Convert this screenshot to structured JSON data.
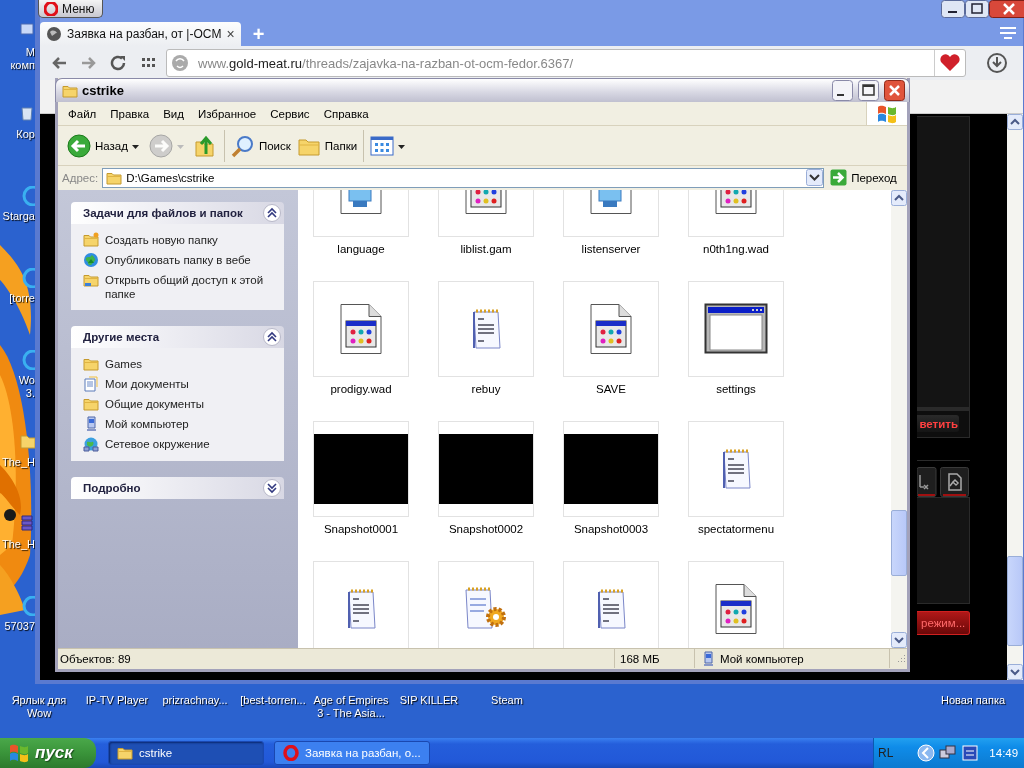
{
  "desktop": {
    "left_icons": [
      {
        "kind": "computer",
        "lines": [
          "М",
          "комп"
        ]
      },
      {
        "kind": "bin",
        "lines": [
          "Кор"
        ]
      },
      {
        "kind": "disc",
        "lines": [
          "Starga"
        ]
      },
      {
        "kind": "disc",
        "lines": [
          "[torre"
        ]
      },
      {
        "kind": "disc",
        "lines": [
          "Wo",
          "3."
        ]
      },
      {
        "kind": "folder",
        "lines": [
          "The_H"
        ]
      },
      {
        "kind": "archive",
        "lines": [
          "The_H"
        ]
      },
      {
        "kind": "disc",
        "lines": [
          "57037"
        ]
      }
    ],
    "bottom_icons": [
      {
        "lines": [
          "Ярлык для",
          "Wow"
        ]
      },
      {
        "lines": [
          "IP-TV Player"
        ]
      },
      {
        "lines": [
          "prizrachnay..."
        ]
      },
      {
        "lines": [
          "[best-torren..."
        ]
      },
      {
        "lines": [
          "Age of Empires",
          "3 - The Asia..."
        ]
      },
      {
        "lines": [
          "SIP KILLER"
        ]
      },
      {
        "lines": [
          "Steam"
        ]
      }
    ],
    "right_icons": [
      {
        "lines": [
          "Новая папка"
        ]
      }
    ]
  },
  "browser": {
    "menu_button": "Меню",
    "tabs": [
      {
        "title": "Заявка на разбан, от |-OCM",
        "close": "×",
        "selected": true
      }
    ],
    "new_tab": "+",
    "url": {
      "prefix": "www.",
      "host": "gold-meat.ru",
      "path": "/threads/zajavka-na-razban-ot-ocm-fedor.6367/"
    },
    "page": {
      "reply_button": "ветить",
      "mode_button": "режим..."
    }
  },
  "explorer": {
    "title": "cstrike",
    "menu": [
      "Файл",
      "Правка",
      "Вид",
      "Избранное",
      "Сервис",
      "Справка"
    ],
    "toolbar": [
      {
        "kind": "back",
        "label": "Назад",
        "disabled": false
      },
      {
        "kind": "forward",
        "disabled": true
      },
      {
        "kind": "up",
        "disabled": false
      },
      {
        "kind": "search",
        "label": "Поиск",
        "disabled": false
      },
      {
        "kind": "folders",
        "label": "Папки",
        "disabled": false
      },
      {
        "kind": "views",
        "disabled": false
      }
    ],
    "address": {
      "label": "Адрес:",
      "value": "D:\\Games\\cstrike",
      "go": "Переход"
    },
    "task_panels": [
      {
        "title": "Задачи для файлов и папок",
        "expanded": true,
        "items": [
          {
            "kind": "new-folder",
            "label": "Создать новую папку"
          },
          {
            "kind": "globe",
            "label": "Опубликовать папку в вебе"
          },
          {
            "kind": "share",
            "label": "Открыть общий доступ к этой папке"
          }
        ]
      },
      {
        "title": "Другие места",
        "expanded": true,
        "items": [
          {
            "kind": "folder",
            "label": "Games"
          },
          {
            "kind": "documents",
            "label": "Мои документы"
          },
          {
            "kind": "folder",
            "label": "Общие документы"
          },
          {
            "kind": "computer",
            "label": "Мой компьютер"
          },
          {
            "kind": "network",
            "label": "Сетевое окружение"
          }
        ]
      },
      {
        "title": "Подробно",
        "expanded": false
      }
    ],
    "files": [
      {
        "name": "language",
        "kind": "system"
      },
      {
        "name": "liblist.gam",
        "kind": "app"
      },
      {
        "name": "listenserver",
        "kind": "system"
      },
      {
        "name": "n0th1ng.wad",
        "kind": "app"
      },
      {
        "name": "prodigy.wad",
        "kind": "app"
      },
      {
        "name": "rebuy",
        "kind": "text"
      },
      {
        "name": "SAVE",
        "kind": "app"
      },
      {
        "name": "settings",
        "kind": "window"
      },
      {
        "name": "Snapshot0001",
        "kind": "snapshot"
      },
      {
        "name": "Snapshot0002",
        "kind": "snapshot"
      },
      {
        "name": "Snapshot0003",
        "kind": "snapshot"
      },
      {
        "name": "spectatormenu",
        "kind": "text"
      },
      {
        "kind": "text"
      },
      {
        "kind": "config"
      },
      {
        "kind": "text"
      },
      {
        "kind": "app"
      }
    ],
    "status": {
      "objects": "Объектов: 89",
      "size": "168 МБ",
      "location": "Мой компьютер"
    }
  },
  "taskbar": {
    "start": "пуск",
    "tasks": [
      {
        "label": "cstrike",
        "kind": "folder",
        "selected": true
      },
      {
        "label": "Заявка на разбан, о...",
        "kind": "browser",
        "selected": false
      }
    ],
    "lang": "RL",
    "clock": "14:49"
  }
}
